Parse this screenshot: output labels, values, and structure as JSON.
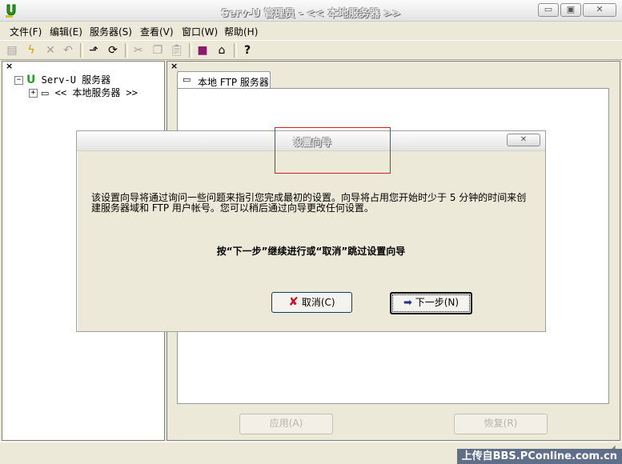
{
  "window": {
    "title": "Serv-U 管理员 - << 本地服务器 >>"
  },
  "menu": [
    "文件(F)",
    "编辑(E)",
    "服务器(S)",
    "查看(V)",
    "窗口(W)",
    "帮助(H)"
  ],
  "tree": {
    "root_label": "Serv-U 服务器",
    "child_label": "<< 本地服务器 >>"
  },
  "tab": {
    "label": "本地 FTP 服务器"
  },
  "panel_buttons": {
    "apply": "应用(A)",
    "restore": "恢复(R)"
  },
  "dialog": {
    "title": "设置向导",
    "body_line1": "该设置向导将通过询问一些问题来指引您完成最初的设置。向导将占用您开始时少于 5 分钟的时间来创",
    "body_line2": "建服务器域和 FTP 用户帐号。您可以稍后通过向导更改任何设置。",
    "hint": "按“下一步”继续进行或“取消”跳过设置向导",
    "cancel_label": "取消(C)",
    "next_label": "下一步(N)"
  },
  "status": {
    "watermark": "上传自BBS.PConline.com.cn"
  },
  "colors": {
    "highlight": "#d52020",
    "next_arrow": "#1f2f8f",
    "cancel_x": "#c8102e"
  }
}
